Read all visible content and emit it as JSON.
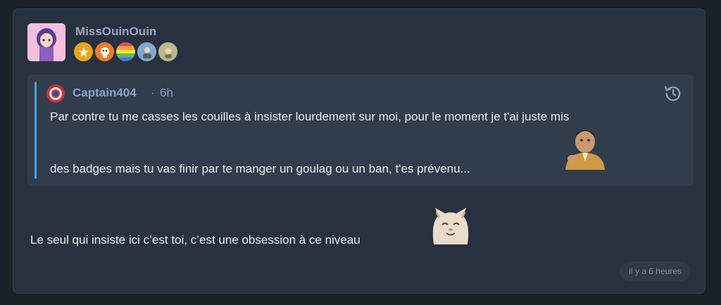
{
  "post": {
    "author": "MissOuinOuin",
    "badges": [
      "star-badge-icon",
      "mascot-badge-icon",
      "rainbow-badge-icon",
      "avatar-badge-icon",
      "character-badge-icon"
    ],
    "quote": {
      "author": "Captain404",
      "separator": "·",
      "time": "6h",
      "line1": "Par contre tu me casses les couilles à insister lourdement sur moi, pour le moment je t'ai juste mis",
      "line2": "des badges mais tu vas finir par te manger un goulag ou un ban, t'es prévenu..."
    },
    "message": "Le seul qui insiste ici c’est toi, c’est une obsession à ce niveau",
    "timestamp": "il y a 6 heures"
  },
  "colors": {
    "background": "#1b2129",
    "card": "#27313f",
    "quote": "#313c4c",
    "quote_bar": "#4aa3e0",
    "username": "#9aa6bf"
  }
}
